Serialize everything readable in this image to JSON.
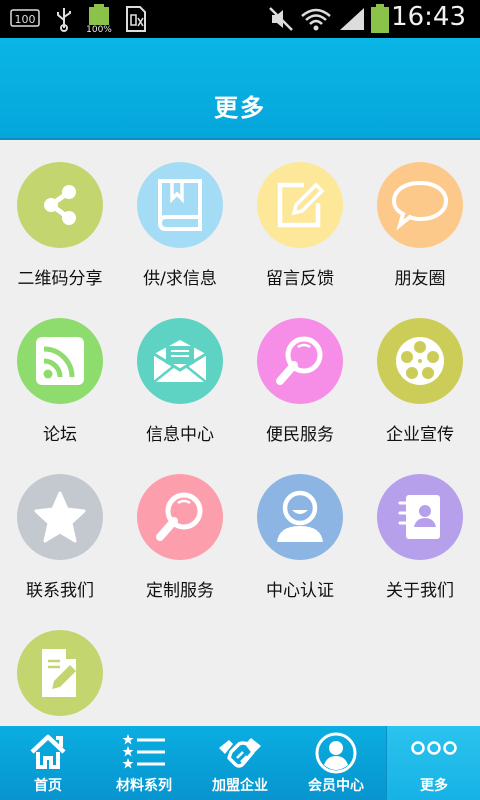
{
  "status_bar": {
    "time": "16:43",
    "battery_badge": "100%",
    "notification_badge": "100"
  },
  "header": {
    "title": "更多"
  },
  "grid_items": [
    {
      "label": "二维码分享",
      "color": "#c3d56f",
      "icon": "share-icon"
    },
    {
      "label": "供/求信息",
      "color": "#a5dcf5",
      "icon": "book-icon"
    },
    {
      "label": "留言反馈",
      "color": "#fde89a",
      "icon": "edit-note-icon"
    },
    {
      "label": "朋友圈",
      "color": "#fdc98a",
      "icon": "chat-bubble-icon"
    },
    {
      "label": "论坛",
      "color": "#8fdc6e",
      "icon": "rss-icon"
    },
    {
      "label": "信息中心",
      "color": "#5fd3c3",
      "icon": "mail-icon"
    },
    {
      "label": "便民服务",
      "color": "#f68ee8",
      "icon": "magnifier-icon"
    },
    {
      "label": "企业宣传",
      "color": "#cccd58",
      "icon": "film-reel-icon"
    },
    {
      "label": "联系我们",
      "color": "#c4c8cf",
      "icon": "star-icon"
    },
    {
      "label": "定制服务",
      "color": "#fd9eac",
      "icon": "magnifier-icon"
    },
    {
      "label": "中心认证",
      "color": "#8cb5e4",
      "icon": "user-icon"
    },
    {
      "label": "关于我们",
      "color": "#b6a0ec",
      "icon": "contact-book-icon"
    },
    {
      "label": "",
      "color": "#c3d56f",
      "icon": "document-edit-icon"
    }
  ],
  "tabbar": {
    "tabs": [
      {
        "label": "首页",
        "icon": "home-icon"
      },
      {
        "label": "材料系列",
        "icon": "list-icon"
      },
      {
        "label": "加盟企业",
        "icon": "handshake-icon"
      },
      {
        "label": "会员中心",
        "icon": "member-icon"
      },
      {
        "label": "更多",
        "icon": "more-dots-icon"
      }
    ],
    "active": "更多"
  }
}
